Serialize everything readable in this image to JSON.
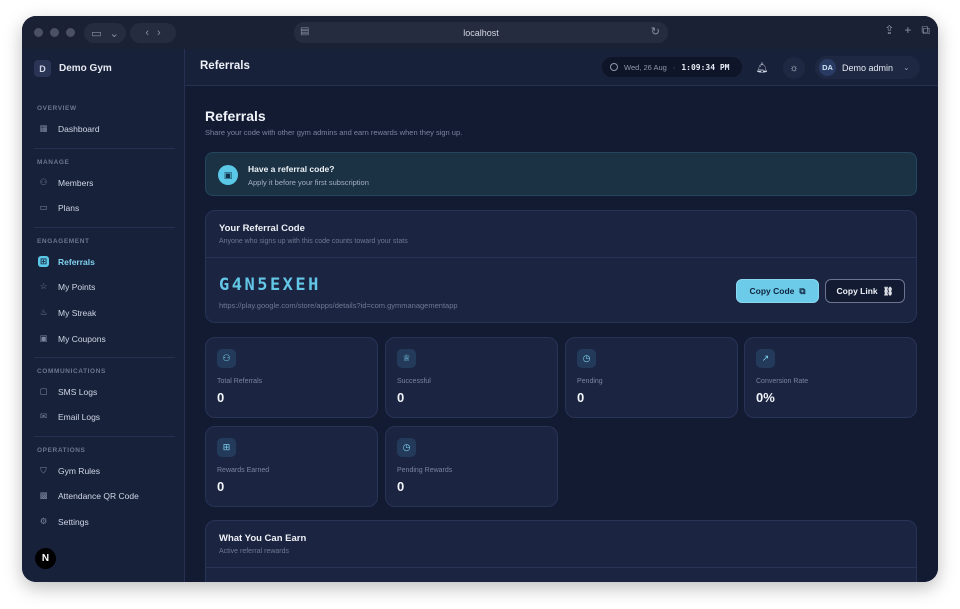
{
  "browser": {
    "url": "localhost"
  },
  "sidebar": {
    "brand_initial": "D",
    "brand_name": "Demo Gym",
    "sections": {
      "overview": "OVERVIEW",
      "manage": "MANAGE",
      "engagement": "ENGAGEMENT",
      "communications": "COMMUNICATIONS",
      "operations": "OPERATIONS"
    },
    "items": {
      "dashboard": "Dashboard",
      "members": "Members",
      "plans": "Plans",
      "referrals": "Referrals",
      "my_points": "My Points",
      "my_streak": "My Streak",
      "my_coupons": "My Coupons",
      "sms_logs": "SMS Logs",
      "email_logs": "Email Logs",
      "gym_rules": "Gym Rules",
      "attendance_qr": "Attendance QR Code",
      "settings": "Settings"
    },
    "footer_badge": "N"
  },
  "topbar": {
    "title": "Referrals",
    "date": "Wed, 26 Aug",
    "time": "1:09:34 PM",
    "user_initials": "DA",
    "user_name": "Demo admin"
  },
  "page": {
    "title": "Referrals",
    "subtitle": "Share your code with other gym admins and earn rewards when they sign up."
  },
  "banner": {
    "title": "Have a referral code?",
    "subtitle": "Apply it before your first subscription"
  },
  "referral_card": {
    "title": "Your Referral Code",
    "subtitle": "Anyone who signs up with this code counts toward your stats",
    "code": "G4N5EXEH",
    "url": "https://play.google.com/store/apps/details?id=com.gymmanagementapp",
    "copy_code_label": "Copy Code",
    "copy_link_label": "Copy Link"
  },
  "stats": [
    {
      "label": "Total Referrals",
      "value": "0",
      "icon": "users-icon"
    },
    {
      "label": "Successful",
      "value": "0",
      "icon": "award-icon"
    },
    {
      "label": "Pending",
      "value": "0",
      "icon": "clock-icon"
    },
    {
      "label": "Conversion Rate",
      "value": "0%",
      "icon": "trending-up-icon"
    },
    {
      "label": "Rewards Earned",
      "value": "0",
      "icon": "gift-icon"
    },
    {
      "label": "Pending Rewards",
      "value": "0",
      "icon": "clock-icon"
    }
  ],
  "earn_card": {
    "title": "What You Can Earn",
    "subtitle": "Active referral rewards"
  }
}
